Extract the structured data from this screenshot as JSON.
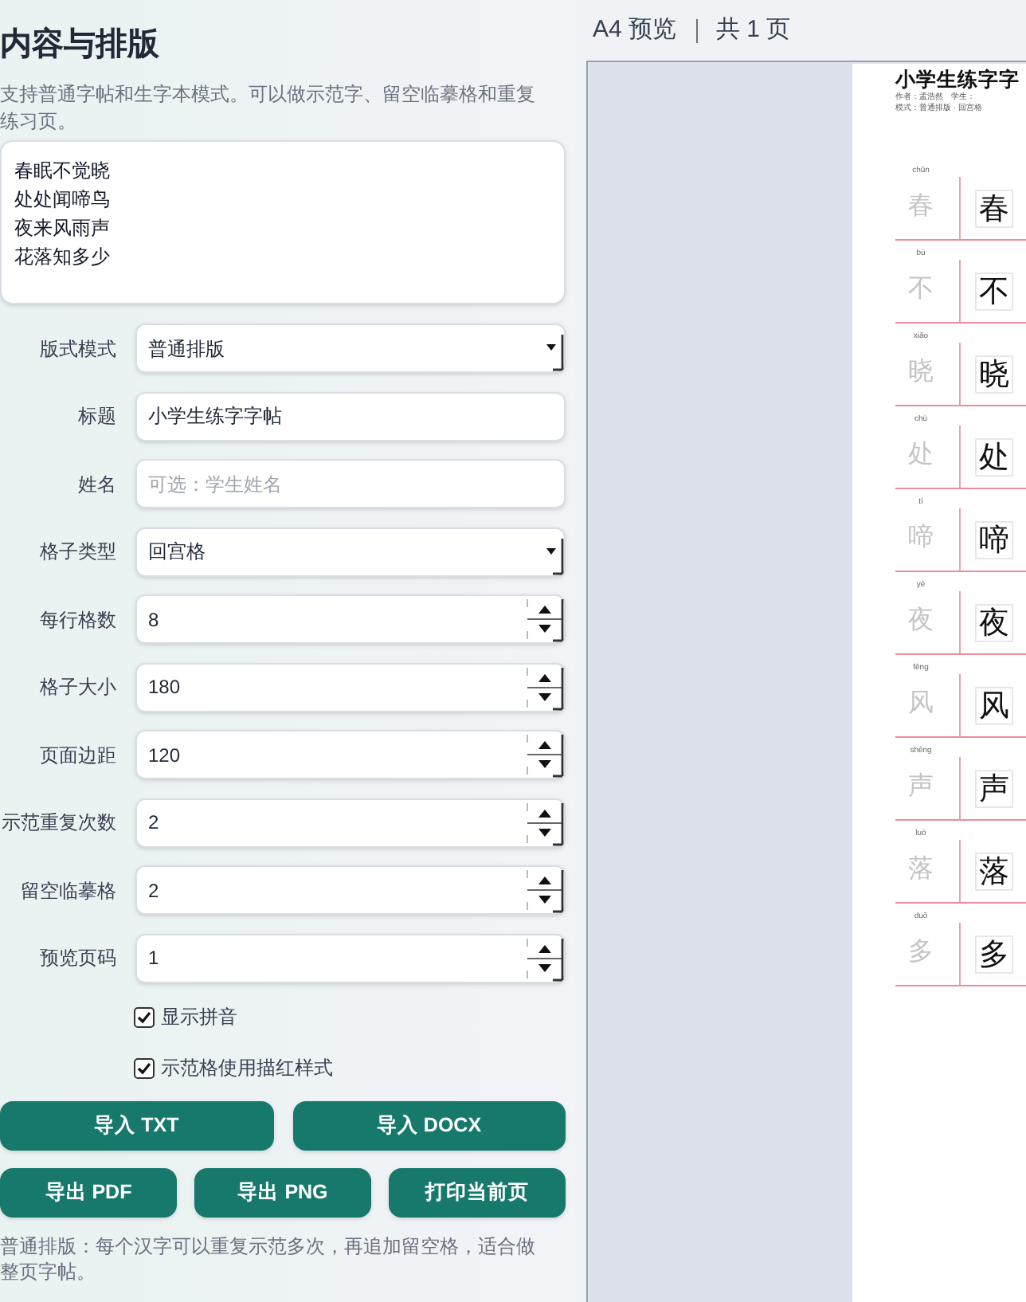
{
  "panel": {
    "title": "内容与排版",
    "description": "支持普通字帖和生字本模式。可以做示范字、留空临摹格和重复练习页。",
    "content_lines": [
      "春眠不觉晓",
      "处处闻啼鸟",
      "夜来风雨声",
      "花落知多少"
    ]
  },
  "fields": [
    {
      "kind": "select",
      "label": "版式模式",
      "value": "普通排版"
    },
    {
      "kind": "text",
      "label": "标题",
      "value": "小学生练字字帖"
    },
    {
      "kind": "text",
      "label": "姓名",
      "placeholder": "可选：学生姓名"
    },
    {
      "kind": "select",
      "label": "格子类型",
      "value": "回宫格"
    },
    {
      "kind": "number",
      "label": "每行格数",
      "value": "8"
    },
    {
      "kind": "number",
      "label": "格子大小",
      "value": "180"
    },
    {
      "kind": "number",
      "label": "页面边距",
      "value": "120"
    },
    {
      "kind": "number",
      "label": "示范重复次数",
      "value": "2"
    },
    {
      "kind": "number",
      "label": "留空临摹格",
      "value": "2"
    },
    {
      "kind": "number",
      "label": "预览页码",
      "value": "1"
    }
  ],
  "checkboxes": [
    {
      "label": "显示拼音",
      "checked": true
    },
    {
      "label": "示范格使用描红样式",
      "checked": true
    }
  ],
  "button_rows": [
    [
      "导入 TXT",
      "导入 DOCX"
    ],
    [
      "导出 PDF",
      "导出 PNG",
      "打印当前页"
    ]
  ],
  "note": "普通排版：每个汉字可以重复示范多次，再追加留空格，适合做整页字帖。",
  "preview": {
    "heading": "A4 预览",
    "page_count": "共 1 页",
    "page": {
      "title": "小学生练字字",
      "meta_lines": [
        "作者：孟浩然　学生：",
        "模式：普通排版 · 回宫格"
      ],
      "rows": [
        {
          "pinyin": "chūn",
          "trace": "春",
          "char": "春"
        },
        {
          "pinyin": "bù",
          "trace": "不",
          "char": "不"
        },
        {
          "pinyin": "xiǎo",
          "trace": "晓",
          "char": "晓"
        },
        {
          "pinyin": "chù",
          "trace": "处",
          "char": "处"
        },
        {
          "pinyin": "tí",
          "trace": "啼",
          "char": "啼"
        },
        {
          "pinyin": "yè",
          "trace": "夜",
          "char": "夜"
        },
        {
          "pinyin": "fēng",
          "trace": "风",
          "char": "风"
        },
        {
          "pinyin": "shēng",
          "trace": "声",
          "char": "声"
        },
        {
          "pinyin": "luò",
          "trace": "落",
          "char": "落"
        },
        {
          "pinyin": "duō",
          "trace": "多",
          "char": "多"
        }
      ]
    }
  }
}
